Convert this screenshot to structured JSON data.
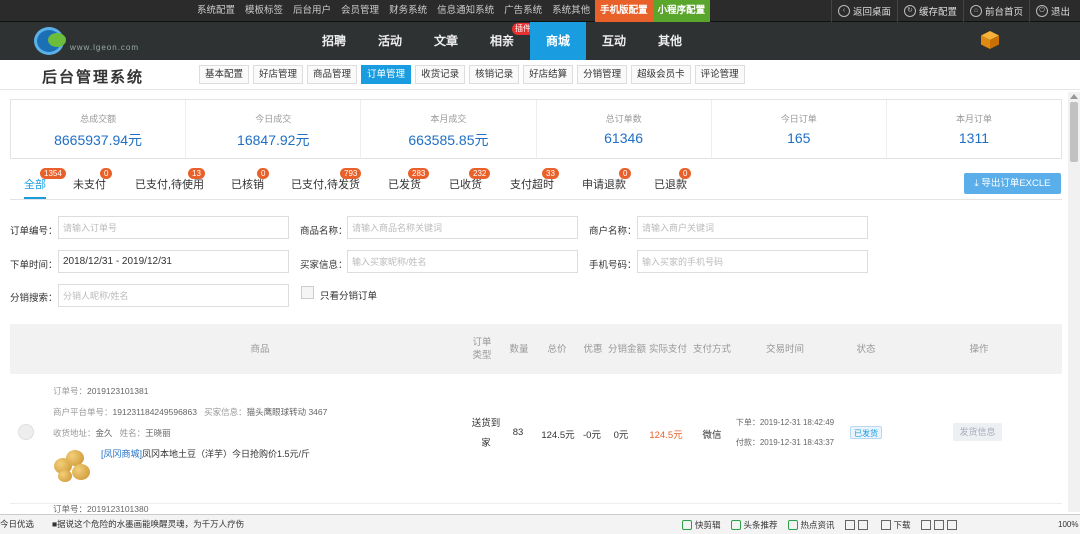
{
  "topbar": {
    "menu": [
      "系统配置",
      "模板标签",
      "后台用户",
      "会员管理",
      "财务系统",
      "信息通知系统",
      "广告系统",
      "系统其他",
      "手机版配置",
      "小程序配置"
    ],
    "right": [
      "返回桌面",
      "缓存配置",
      "前台首页",
      "退出"
    ]
  },
  "navbar": {
    "logo_text": "www.lgeon.com",
    "items": [
      "招聘",
      "活动",
      "文章",
      "相亲",
      "商城",
      "互动",
      "其他"
    ],
    "plugin_badge": "插件"
  },
  "subheader": {
    "title": "后台管理系统",
    "tabs": [
      "基本配置",
      "好店管理",
      "商品管理",
      "订单管理",
      "收货记录",
      "核销记录",
      "好店结算",
      "分销管理",
      "超级会员卡",
      "评论管理"
    ]
  },
  "stats": [
    {
      "label": "总成交额",
      "value": "8665937.94元"
    },
    {
      "label": "今日成交",
      "value": "16847.92元"
    },
    {
      "label": "本月成交",
      "value": "663585.85元"
    },
    {
      "label": "总订单数",
      "value": "61346"
    },
    {
      "label": "今日订单",
      "value": "165"
    },
    {
      "label": "本月订单",
      "value": "1311"
    }
  ],
  "status_tabs": [
    {
      "label": "全部",
      "count": "1354"
    },
    {
      "label": "未支付",
      "count": "0"
    },
    {
      "label": "已支付,待使用",
      "count": "13"
    },
    {
      "label": "已核销",
      "count": "0"
    },
    {
      "label": "已支付,待发货",
      "count": "793"
    },
    {
      "label": "已发货",
      "count": "283"
    },
    {
      "label": "已收货",
      "count": "232"
    },
    {
      "label": "支付超时",
      "count": "33"
    },
    {
      "label": "申请退款",
      "count": "0"
    },
    {
      "label": "已退款",
      "count": "0"
    }
  ],
  "export_button": "导出订单EXCLE",
  "filters": {
    "order_no": {
      "label": "订单编号：",
      "placeholder": "请输入订单号"
    },
    "product_name": {
      "label": "商品名称：",
      "placeholder": "请输入商品名称关键词"
    },
    "merchant_name": {
      "label": "商户名称：",
      "placeholder": "请输入商户关键词"
    },
    "order_time": {
      "label": "下单时间：",
      "value": "2018/12/31 - 2019/12/31"
    },
    "buyer_info": {
      "label": "买家信息：",
      "placeholder": "输入买家昵称/姓名"
    },
    "phone": {
      "label": "手机号码：",
      "placeholder": "输入买家的手机号码"
    },
    "distributor_search": {
      "label": "分销搜索：",
      "placeholder": "分销人昵称/姓名"
    },
    "only_distribution": "只看分销订单"
  },
  "table_headers": [
    "商品",
    "订单类型",
    "数量",
    "总价",
    "优惠",
    "分销金额",
    "实际支付",
    "支付方式",
    "交易时间",
    "状态",
    "操作"
  ],
  "orders": [
    {
      "order_no_label": "订单号：",
      "order_no": "2019123101381",
      "merchant_no_label": "商户平台单号：",
      "merchant_no": "191231184249596863",
      "buyer_label": "买家信息：",
      "buyer": "猫头鹰眼球转动 3467",
      "address_label": "收货地址：",
      "address": "金久",
      "name_label": "姓名：",
      "name": "王晓丽",
      "shop": "[凤冈商城]",
      "product": "凤冈本地土豆（洋芋）今日抢购价1.5元/斤",
      "order_type": "送货到家",
      "quantity": "83",
      "total": "124.5元",
      "discount": "-0元",
      "distribution": "0元",
      "paid": "124.5元",
      "pay_method": "微信",
      "order_time": "下单：2019-12-31 18:42:49",
      "pay_time": "付款：2019-12-31 18:43:37",
      "status": "已发货",
      "action": "发货信息"
    },
    {
      "order_no_label": "订单号：",
      "order_no": "2019123101380"
    }
  ],
  "taskbar": {
    "left": "今日优选",
    "news": "■据说这个危险的水墨画能唤醒灵魂，为千万人疗伤",
    "right": [
      "快剪辑",
      "头条推荐",
      "热点资讯"
    ],
    "download": "下载",
    "zoom": "100%"
  },
  "colors": {
    "accent": "#1a9de0",
    "orange": "#e9612a",
    "green": "#5aa52b",
    "dark": "#2f3233"
  }
}
